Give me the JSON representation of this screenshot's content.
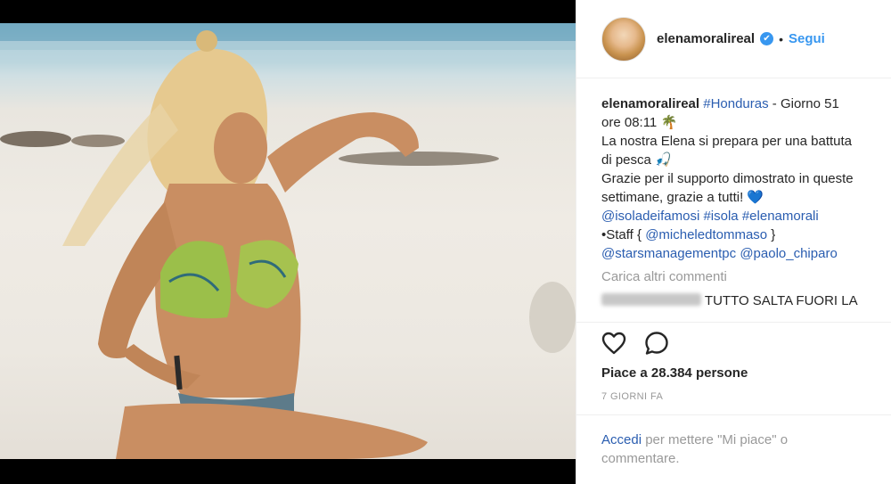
{
  "post": {
    "username": "elenamoralireal",
    "verified_badge": "✔",
    "dot": "•",
    "follow_label": "Segui"
  },
  "caption": {
    "username": "elenamoralireal",
    "hashtag_honduras": "#Honduras",
    "text1": " - Giorno 51",
    "text2": "ore 08:11 🌴",
    "text3": "La nostra Elena si prepara per una battuta",
    "text4": "di pesca 🎣",
    "text5": "Grazie per il supporto dimostrato in queste",
    "text6": "settimane, grazie a tutti! 💙",
    "tag_isola_famosi": "@isoladeifamosi",
    "tag_isola": "#isola",
    "tag_elenamorali": "#elenamorali",
    "staff_prefix": "•Staff { ",
    "tag_micheledtommaso": "@micheledtommaso",
    "staff_suffix": " }",
    "tag_starsmanagement": "@starsmanagementpc",
    "tag_paolo": "@paolo_chiparo"
  },
  "load_more_label": "Carica altri commenti",
  "comment2": {
    "text": "TUTTO SALTA FUORI LA"
  },
  "actions": {
    "like_icon": "heart-outline-icon",
    "comment_icon": "comment-bubble-icon"
  },
  "likes": {
    "prefix": "Piace a ",
    "count": "28.384",
    "suffix": " persone"
  },
  "time_label": "7 GIORNI FA",
  "login": {
    "link": "Accedi",
    "rest": " per mettere \"Mi piace\" o commentare."
  },
  "colors": {
    "accent": "#3897f0",
    "link": "#2a5db0",
    "muted": "#999999",
    "text": "#262626"
  }
}
